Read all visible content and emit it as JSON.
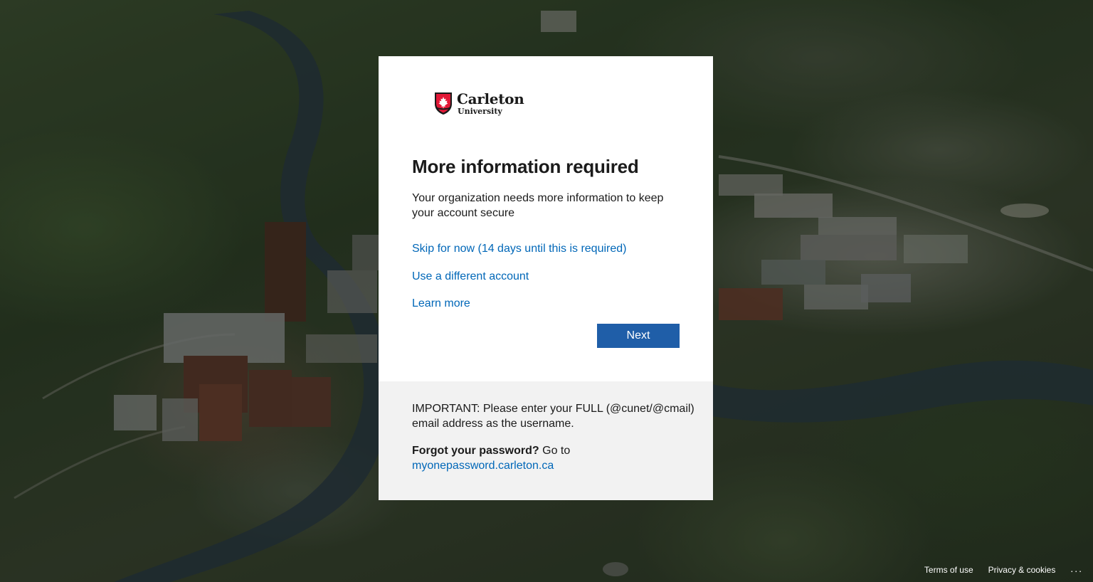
{
  "brand": {
    "name": "Carleton",
    "subname": "University",
    "crest_icon": "maple-leaf-shield-icon",
    "colors": {
      "red": "#e31837",
      "black": "#1a1a1a"
    }
  },
  "card": {
    "title": "More information required",
    "description": "Your organization needs more information to keep your account secure",
    "links": {
      "skip": "Skip for now (14 days until this is required)",
      "different_account": "Use a different account",
      "learn_more": "Learn more"
    },
    "next_button": "Next"
  },
  "card_footer": {
    "important_note": "IMPORTANT: Please enter your FULL (@cunet/@cmail) email address as the username.",
    "forgot_label": "Forgot your password?",
    "forgot_goto": " Go to",
    "forgot_link": "myonepassword.carleton.ca"
  },
  "footer": {
    "terms": "Terms of use",
    "privacy": "Privacy & cookies",
    "more": "..."
  },
  "theme": {
    "link_color": "#0067b8",
    "button_color": "#1f5ea8",
    "card_footer_bg": "#f2f2f2"
  }
}
